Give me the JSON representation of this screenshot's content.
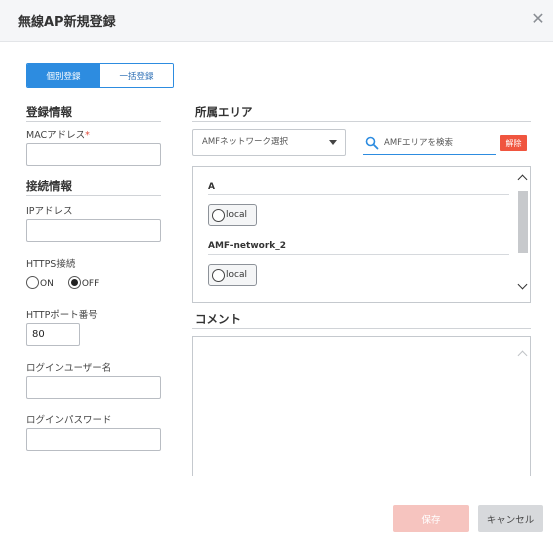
{
  "dialog": {
    "title": "無線AP新規登録",
    "close_icon": "close-icon"
  },
  "mode_tabs": {
    "individual": "個別登録",
    "bulk": "一括登録",
    "selected": "個別登録"
  },
  "registration": {
    "section_title": "登録情報",
    "mac_label": "MACアドレス",
    "mac_required_mark": "*",
    "mac_value": ""
  },
  "connection": {
    "section_title": "接続情報",
    "ip_label": "IPアドレス",
    "ip_value": "",
    "https_label": "HTTPS接続",
    "https_options": [
      "ON",
      "OFF"
    ],
    "https_selected": "OFF",
    "port_label": "HTTPポート番号",
    "port_value": "80",
    "user_label": "ログインユーザー名",
    "user_value": "",
    "password_label": "ログインパスワード",
    "password_value": ""
  },
  "area": {
    "section_title": "所属エリア",
    "network_select": "AMFネットワーク選択",
    "search_placeholder": "AMFエリアを検索",
    "clear_button": "解除",
    "groups": [
      {
        "title": "A",
        "option": "local"
      },
      {
        "title": "AMF-network_2",
        "option": "local"
      }
    ]
  },
  "comment": {
    "section_title": "コメント",
    "value": ""
  },
  "footer": {
    "save_button": "保存",
    "cancel_button": "キャンセル"
  },
  "colors": {
    "accent": "#2d8ce0",
    "danger": "#f0553f",
    "save_disabled": "#f6c4bf"
  }
}
